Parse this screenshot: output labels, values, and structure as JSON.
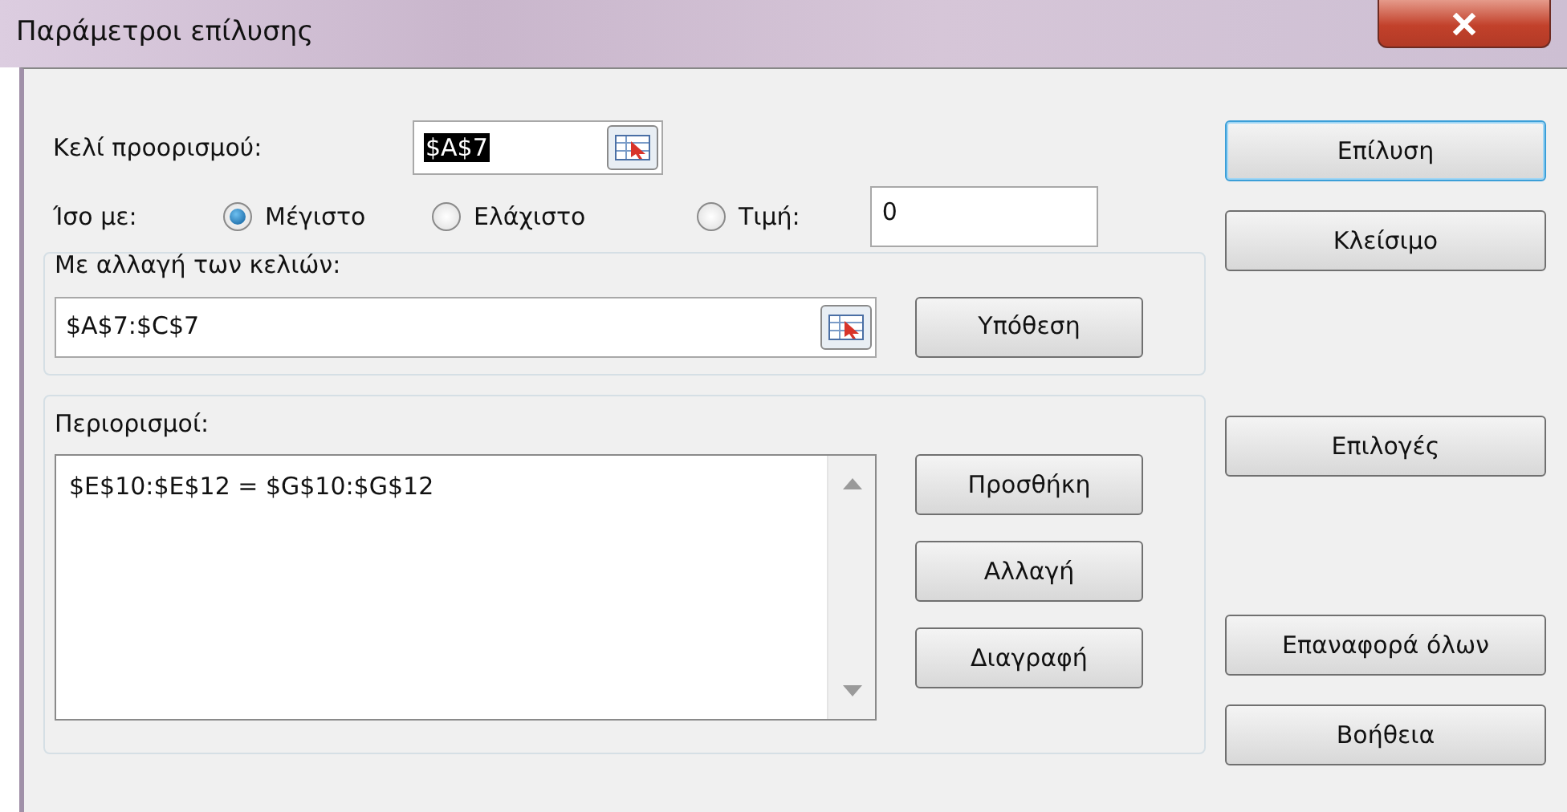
{
  "window": {
    "title": "Παράμετροι επίλυσης"
  },
  "target": {
    "label": "Κελί προορισμού:",
    "value": "$A$7",
    "highlighted": true
  },
  "equal_to": {
    "label": "Ίσο με:",
    "options": [
      {
        "label": "Μέγιστο",
        "selected": true
      },
      {
        "label": "Ελάχιστο",
        "selected": false
      },
      {
        "label": "Τιμή:",
        "selected": false
      }
    ],
    "value": "0"
  },
  "changing_cells": {
    "title": "Με αλλαγή των κελιών:",
    "value": "$A$7:$C$7",
    "button": "Υπόθεση"
  },
  "constraints": {
    "title": "Περιορισμοί:",
    "items": [
      "$E$10:$E$12 = $G$10:$G$12"
    ],
    "buttons": [
      "Προσθήκη",
      "Αλλαγή",
      "Διαγραφή"
    ]
  },
  "side_buttons": [
    {
      "label": "Επίλυση",
      "default": true
    },
    {
      "label": "Κλείσιμο",
      "default": false
    },
    {
      "label": "Επιλογές",
      "default": false
    },
    {
      "label": "Επαναφορά όλων",
      "default": false
    },
    {
      "label": "Βοήθεια",
      "default": false
    }
  ]
}
